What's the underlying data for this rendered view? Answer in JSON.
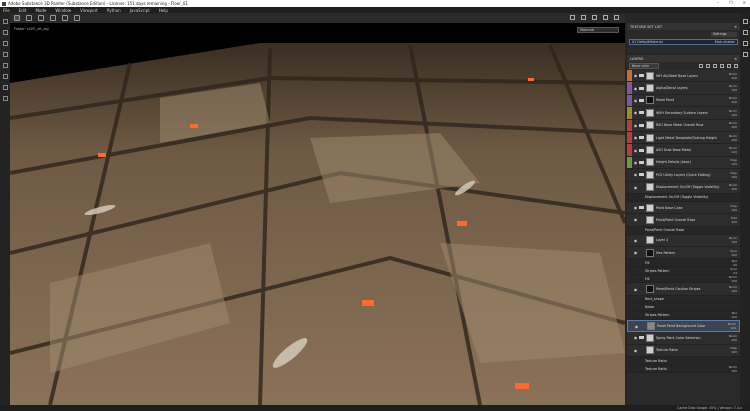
{
  "window": {
    "title": "Adobe Substance 3D Painter (Substance Edition) - License: 151 days remaining - Floor_01",
    "controls": [
      "–",
      "❐",
      "✕"
    ]
  },
  "menu": [
    "File",
    "Edit",
    "Mode",
    "Window",
    "Viewport",
    "Python",
    "JavaScript",
    "Help"
  ],
  "viewport": {
    "label": "Folder: sCIFI_ult_xaj",
    "display_mode": "Material"
  },
  "texture_set_list": {
    "title": "TEXTURE SET LIST",
    "settings": "Settings",
    "item": "01 DefaultMaterial",
    "shader": "Main shader"
  },
  "layers": {
    "title": "LAYERS",
    "blend_channel": "Base color",
    "items": [
      {
        "name": "WFI Alt/Steel Base Layers",
        "blend": "Norm",
        "op": "100",
        "color": "#c0703a",
        "type": "folder"
      },
      {
        "name": "Alpha/Decal Layers",
        "blend": "Norm",
        "op": "100",
        "color": "#7a5a9a",
        "type": "folder"
      },
      {
        "name": "Panel Paint",
        "blend": "Norm",
        "op": "100",
        "color": "#7a5a9a",
        "type": "folder-mask"
      },
      {
        "name": "WSH Secondary Surface Layers",
        "blend": "Norm",
        "op": "100",
        "color": "#a08a30",
        "type": "folder"
      },
      {
        "name": "RSO Base Metal Overall Rust",
        "blend": "Norm",
        "op": "100",
        "color": "#b04040",
        "type": "folder"
      },
      {
        "name": "Light Metal Toneplate/Grating Height",
        "blend": "Norm",
        "op": "100",
        "color": "#b04040",
        "type": "folder"
      },
      {
        "name": "ASO Dust Base Metal",
        "blend": "Norm",
        "op": "100",
        "color": "#b04040",
        "type": "folder"
      },
      {
        "name": "Height Details (base)",
        "blend": "Disp",
        "op": "100",
        "color": "#6a9a40",
        "type": "folder"
      },
      {
        "name": "PCS Utility Layers (Quick Editing)",
        "blend": "Disp",
        "op": "100",
        "color": "",
        "type": "folder"
      },
      {
        "name": "Displacement On/Off (Toggle Visibility)",
        "blend": "Norm",
        "op": "100",
        "color": "",
        "type": "fill"
      },
      {
        "name": "Displacement On/Off (Toggle Visibility)",
        "blend": "",
        "op": "",
        "color": "",
        "type": "effect"
      },
      {
        "name": "Paint Base Color",
        "blend": "Disp",
        "op": "100",
        "color": "",
        "type": "folder"
      },
      {
        "name": "Paint/Paint Overall Base",
        "blend": "Filte",
        "op": "100",
        "color": "",
        "type": "fill"
      },
      {
        "name": "Paint/Paint Overall Base",
        "blend": "",
        "op": "",
        "color": "",
        "type": "effect"
      },
      {
        "name": "Layer 2",
        "blend": "Norm",
        "op": "100",
        "color": "",
        "type": "fill"
      },
      {
        "name": "Hex Pattern",
        "blend": "Sum",
        "op": "100",
        "color": "",
        "type": "mask"
      },
      {
        "name": "Fill",
        "blend": "Mul",
        "op": "20",
        "color": "",
        "type": "effect"
      },
      {
        "name": "Stripes Pattern",
        "blend": "Sum",
        "op": "24",
        "color": "",
        "type": "effect"
      },
      {
        "name": "Fill",
        "blend": "Norm",
        "op": "100",
        "color": "",
        "type": "effect"
      },
      {
        "name": "Panel/Paint Caution Stripes",
        "blend": "Norm",
        "op": "100",
        "color": "",
        "type": "mask"
      },
      {
        "name": "Rect_shape",
        "blend": "",
        "op": "",
        "color": "",
        "type": "effect"
      },
      {
        "name": "Noise",
        "blend": "",
        "op": "",
        "color": "",
        "type": "effect"
      },
      {
        "name": "Stripes Pattern",
        "blend": "Mul",
        "op": "100",
        "color": "",
        "type": "effect"
      },
      {
        "name": "Panel Paint Background Color",
        "blend": "Norm",
        "op": "100",
        "color": "",
        "type": "selected"
      },
      {
        "name": "Spray Paint Color Selection",
        "blend": "Norm",
        "op": "100",
        "color": "",
        "type": "folder"
      },
      {
        "name": "Texture Ratio",
        "blend": "Disp",
        "op": "100",
        "color": "",
        "type": "fill"
      },
      {
        "name": "Texture Ratio",
        "blend": "",
        "op": "",
        "color": "",
        "type": "effect"
      },
      {
        "name": "Texture Ratio",
        "blend": "Norm",
        "op": "100",
        "color": "",
        "type": "effect"
      }
    ]
  },
  "status": "Cache Disk Usage: 45% | Version: 7.4.x"
}
